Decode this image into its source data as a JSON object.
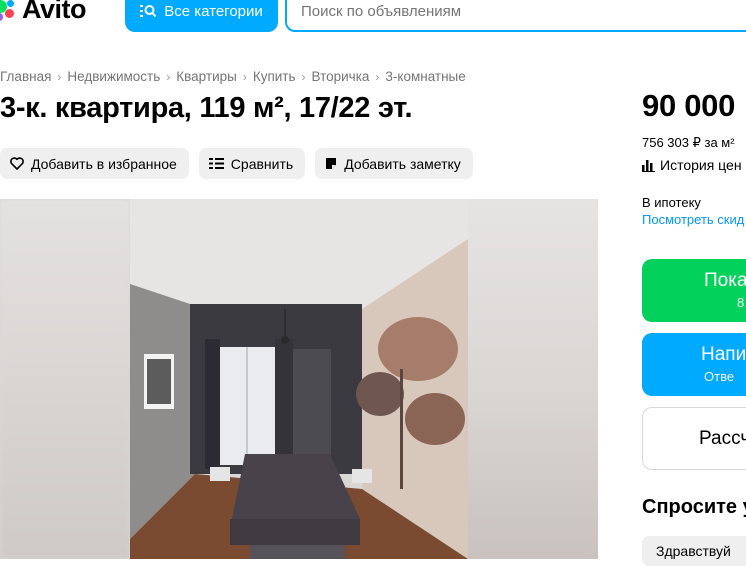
{
  "header": {
    "logo_text": "Avito",
    "logo_colors": [
      "#04e061",
      "#ff4053",
      "#965eeb",
      "#0af"
    ],
    "categories_label": "Все категории",
    "search_placeholder": "Поиск по объявлениям"
  },
  "breadcrumbs": [
    "Главная",
    "Недвижимость",
    "Квартиры",
    "Купить",
    "Вторичка",
    "3-комнатные"
  ],
  "listing": {
    "title": "3-к. квартира, 119 м², 17/22 эт.",
    "actions": {
      "favorite": "Добавить в избранное",
      "compare": "Сравнить",
      "note": "Добавить заметку"
    }
  },
  "sidebar": {
    "price": "90 000",
    "price_per_m2": "756 303 ₽ за м²",
    "history_label": "История цен",
    "mortgage_label": "В ипотеку",
    "discount_link": "Посмотреть скид",
    "show_phone": {
      "label": "Пока",
      "sub": "8"
    },
    "write": {
      "label": "Напис",
      "sub": "Отве"
    },
    "third_button": "Рассч",
    "ask_title": "Спросите у",
    "chip_label": "Здравствуй"
  },
  "colors": {
    "accent_blue": "#00aaff",
    "green": "#02d15c",
    "link_blue": "#0099f7",
    "muted_text": "#757575",
    "chip_bg": "#efefef"
  }
}
